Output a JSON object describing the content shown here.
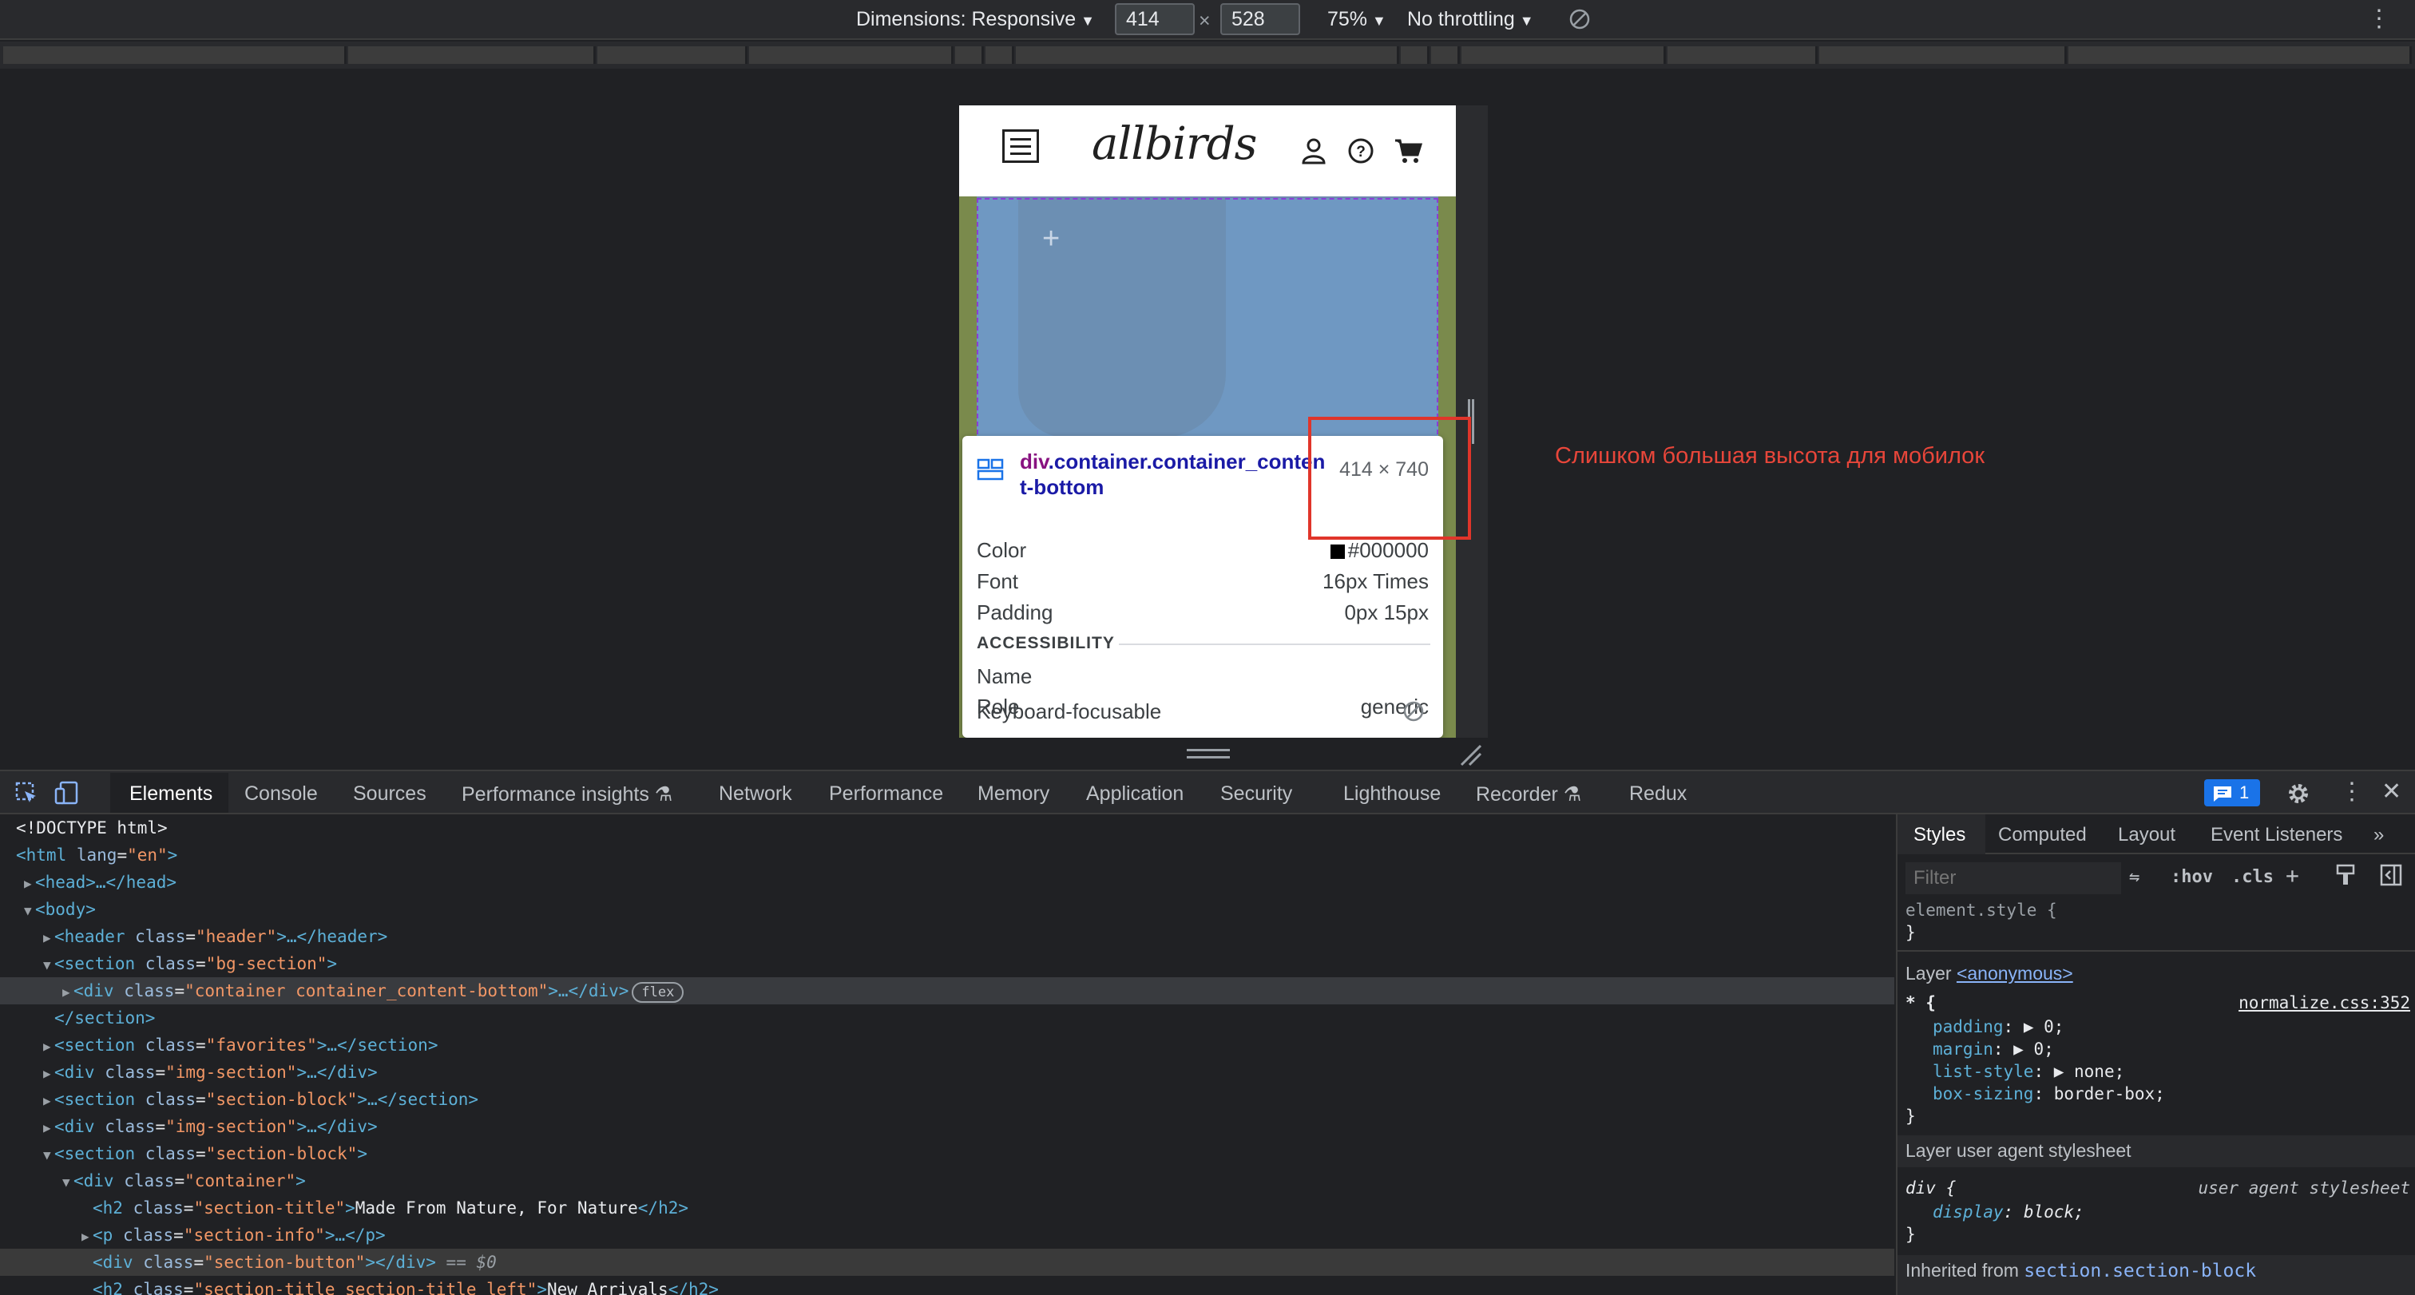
{
  "device_toolbar": {
    "dimensions_label": "Dimensions: Responsive",
    "width_value": "414",
    "times": "×",
    "height_value": "528",
    "zoom": "75%",
    "throttling": "No throttling"
  },
  "site": {
    "logo": "allbirds"
  },
  "inspect_tooltip": {
    "tag": "div",
    "classes": ".container.container_content-bottom",
    "size": "414 × 740",
    "rows": [
      {
        "label": "Color",
        "value": "#000000"
      },
      {
        "label": "Font",
        "value": "16px Times"
      },
      {
        "label": "Padding",
        "value": "0px 15px"
      }
    ],
    "accessibility_heading": "ACCESSIBILITY",
    "accessibility_rows": [
      {
        "label": "Name",
        "value": ""
      },
      {
        "label": "Role",
        "value": "generic"
      },
      {
        "label": "Keyboard-focusable",
        "value": ""
      }
    ]
  },
  "annotation": {
    "text": "Слишком большая высота для мобилок",
    "color": "#e0352a"
  },
  "devtools": {
    "tabs": [
      "Elements",
      "Console",
      "Sources",
      "Performance insights",
      "Network",
      "Performance",
      "Memory",
      "Application",
      "Security",
      "Lighthouse",
      "Recorder",
      "Redux"
    ],
    "issues_count": "1",
    "dom": [
      {
        "indent": 0,
        "arrow": "",
        "tag": "<!DOCTYPE html>",
        "plain": true
      },
      {
        "indent": 0,
        "arrow": "",
        "open": "<html",
        "attrs": [
          {
            "n": "lang",
            "v": "\"en\""
          }
        ],
        "close": ">"
      },
      {
        "indent": 1,
        "arrow": "▶",
        "open": "<head",
        "attrs": [],
        "close": ">…</head>"
      },
      {
        "indent": 1,
        "arrow": "▼",
        "open": "<body",
        "attrs": [],
        "close": ">"
      },
      {
        "indent": 2,
        "arrow": "▶",
        "open": "<header",
        "attrs": [
          {
            "n": "class",
            "v": "\"header\""
          }
        ],
        "close": ">…</header>"
      },
      {
        "indent": 2,
        "arrow": "▼",
        "open": "<section",
        "attrs": [
          {
            "n": "class",
            "v": "\"bg-section\""
          }
        ],
        "close": ">"
      },
      {
        "indent": 3,
        "arrow": "▶",
        "open": "<div",
        "attrs": [
          {
            "n": "class",
            "v": "\"container container_content-bottom\""
          }
        ],
        "close": ">…</div>",
        "badge": "flex",
        "hl": true
      },
      {
        "indent": 2,
        "arrow": "",
        "open": "</section>",
        "attrs": [],
        "close": ""
      },
      {
        "indent": 2,
        "arrow": "▶",
        "open": "<section",
        "attrs": [
          {
            "n": "class",
            "v": "\"favorites\""
          }
        ],
        "close": ">…</section>"
      },
      {
        "indent": 2,
        "arrow": "▶",
        "open": "<div",
        "attrs": [
          {
            "n": "class",
            "v": "\"img-section\""
          }
        ],
        "close": ">…</div>"
      },
      {
        "indent": 2,
        "arrow": "▶",
        "open": "<section",
        "attrs": [
          {
            "n": "class",
            "v": "\"section-block\""
          }
        ],
        "close": ">…</section>"
      },
      {
        "indent": 2,
        "arrow": "▶",
        "open": "<div",
        "attrs": [
          {
            "n": "class",
            "v": "\"img-section\""
          }
        ],
        "close": ">…</div>"
      },
      {
        "indent": 2,
        "arrow": "▼",
        "open": "<section",
        "attrs": [
          {
            "n": "class",
            "v": "\"section-block\""
          }
        ],
        "close": ">"
      },
      {
        "indent": 3,
        "arrow": "▼",
        "open": "<div",
        "attrs": [
          {
            "n": "class",
            "v": "\"container\""
          }
        ],
        "close": ">"
      },
      {
        "indent": 4,
        "arrow": "",
        "open": "<h2",
        "attrs": [
          {
            "n": "class",
            "v": "\"section-title\""
          }
        ],
        "close": ">",
        "text": "Made From Nature, For Nature",
        "end": "</h2>"
      },
      {
        "indent": 4,
        "arrow": "▶",
        "open": "<p",
        "attrs": [
          {
            "n": "class",
            "v": "\"section-info\""
          }
        ],
        "close": ">…</p>"
      },
      {
        "indent": 4,
        "arrow": "",
        "open": "<div",
        "attrs": [
          {
            "n": "class",
            "v": "\"section-button\""
          }
        ],
        "close": "></div>",
        "dollar": " == $0",
        "sel": true
      },
      {
        "indent": 4,
        "arrow": "",
        "open": "<h2",
        "attrs": [
          {
            "n": "class",
            "v": "\"section-title section-title_left\""
          }
        ],
        "close": ">",
        "text": "New Arrivals",
        "end": "</h2>"
      }
    ]
  },
  "styles_pane": {
    "tabs": [
      "Styles",
      "Computed",
      "Layout",
      "Event Listeners"
    ],
    "filter_placeholder": "Filter",
    "hov": ":hov",
    "cls": ".cls",
    "element_style": "element.style {",
    "close_brace": "}",
    "layer_label": "Layer",
    "layer_link": "<anonymous>",
    "rule1_selector": "* {",
    "rule1_source": "normalize.css:352",
    "rule1_props": [
      {
        "p": "padding",
        "v": "▶ 0;"
      },
      {
        "p": "margin",
        "v": "▶ 0;"
      },
      {
        "p": "list-style",
        "v": "▶ none;"
      },
      {
        "p": "box-sizing",
        "v": "border-box;"
      }
    ],
    "layer_ua": "Layer user agent stylesheet",
    "rule2_selector": "div {",
    "rule2_source": "user agent stylesheet",
    "rule2_prop": "display",
    "rule2_value": "block;",
    "inherited_label": "Inherited from",
    "inherited_from": "section.section-block"
  }
}
